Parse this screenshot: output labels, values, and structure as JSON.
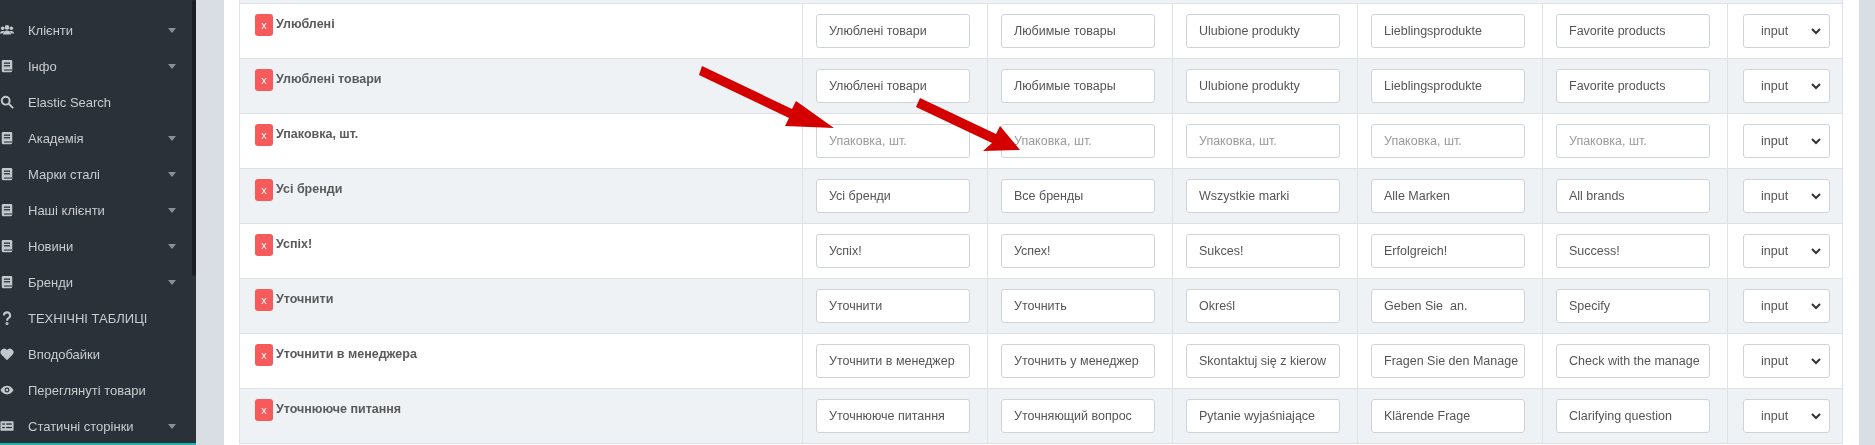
{
  "sidebar": {
    "items": [
      {
        "label": "Клієнти",
        "has_submenu": true
      },
      {
        "label": "Інфо",
        "has_submenu": true
      },
      {
        "label": "Elastic Search",
        "has_submenu": false
      },
      {
        "label": "Академія",
        "has_submenu": true
      },
      {
        "label": "Марки сталі",
        "has_submenu": true
      },
      {
        "label": "Наші клієнти",
        "has_submenu": true
      },
      {
        "label": "Новини",
        "has_submenu": true
      },
      {
        "label": "Бренди",
        "has_submenu": true
      },
      {
        "label": "ТЕХНІЧНІ ТАБЛИЦІ",
        "has_submenu": false
      },
      {
        "label": "Вподобайки",
        "has_submenu": false
      },
      {
        "label": "Переглянуті товари",
        "has_submenu": false
      },
      {
        "label": "Статичні сторінки",
        "has_submenu": true
      }
    ]
  },
  "table": {
    "rows": [
      {
        "remove": "x",
        "key": "Улюблені",
        "cells": [
          {
            "value": "Улюблені товари"
          },
          {
            "value": "Любимые товары"
          },
          {
            "value": "Ulubione produkty"
          },
          {
            "value": "Lieblingsprodukte"
          },
          {
            "value": "Favorite products"
          }
        ],
        "type": "input"
      },
      {
        "remove": "x",
        "key": "Улюблені товари",
        "cells": [
          {
            "value": "Улюблені товари"
          },
          {
            "value": "Любимые товары"
          },
          {
            "value": "Ulubione produkty"
          },
          {
            "value": "Lieblingsprodukte"
          },
          {
            "value": "Favorite products"
          }
        ],
        "type": "input"
      },
      {
        "remove": "x",
        "key": "Упаковка, шт.",
        "cells": [
          {
            "placeholder": "Упаковка, шт."
          },
          {
            "placeholder": "Упаковка, шт."
          },
          {
            "placeholder": "Упаковка, шт."
          },
          {
            "placeholder": "Упаковка, шт."
          },
          {
            "placeholder": "Упаковка, шт."
          }
        ],
        "type": "input"
      },
      {
        "remove": "x",
        "key": "Усі бренди",
        "cells": [
          {
            "value": "Усі бренди"
          },
          {
            "value": "Все бренды"
          },
          {
            "value": "Wszystkie marki"
          },
          {
            "value": "Alle Marken"
          },
          {
            "value": "All brands"
          }
        ],
        "type": "input"
      },
      {
        "remove": "x",
        "key": "Успіх!",
        "cells": [
          {
            "value": "Успіх!"
          },
          {
            "value": "Успех!"
          },
          {
            "value": "Sukces!"
          },
          {
            "value": "Erfolgreich!"
          },
          {
            "value": "Success!"
          }
        ],
        "type": "input"
      },
      {
        "remove": "x",
        "key": "Уточнити",
        "cells": [
          {
            "value": "Уточнити"
          },
          {
            "value": "Уточнить"
          },
          {
            "value": "Określ"
          },
          {
            "value": "Geben Sie  an."
          },
          {
            "value": "Specify"
          }
        ],
        "type": "input"
      },
      {
        "remove": "x",
        "key": "Уточнити в менеджера",
        "cells": [
          {
            "value": "Уточнити в менеджер"
          },
          {
            "value": "Уточнить у менеджер"
          },
          {
            "value": "Skontaktuj się z kierow"
          },
          {
            "value": "Fragen Sie den Manage"
          },
          {
            "value": "Check with the manage"
          }
        ],
        "type": "input"
      },
      {
        "remove": "x",
        "key": "Уточнююче питання",
        "cells": [
          {
            "value": "Уточнююче питання"
          },
          {
            "value": "Уточняющий вопрос"
          },
          {
            "value": "Pytanie wyjaśniające"
          },
          {
            "value": "Klärende Frage"
          },
          {
            "value": "Clarifying question"
          }
        ],
        "type": "input"
      }
    ]
  }
}
